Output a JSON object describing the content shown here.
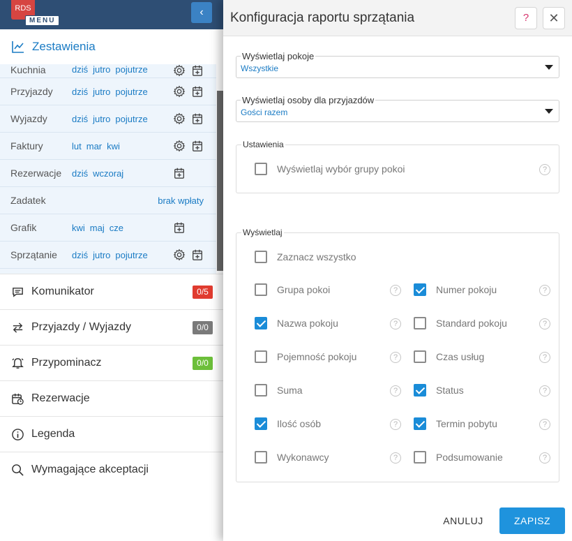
{
  "app": {
    "logo_text": "RDS",
    "menu_label": "MENU",
    "collapse_glyph": "‹"
  },
  "sidebar": {
    "section_title": "Zestawienia",
    "reports": [
      {
        "name": "Kuchnia",
        "links": [
          "dziś",
          "jutro",
          "pojutrze"
        ],
        "icons": [
          "gear-icon",
          "calendar-add-icon"
        ],
        "right_text": ""
      },
      {
        "name": "Przyjazdy",
        "links": [
          "dziś",
          "jutro",
          "pojutrze"
        ],
        "icons": [
          "gear-icon",
          "calendar-add-icon"
        ],
        "right_text": ""
      },
      {
        "name": "Wyjazdy",
        "links": [
          "dziś",
          "jutro",
          "pojutrze"
        ],
        "icons": [
          "gear-icon",
          "calendar-add-icon"
        ],
        "right_text": ""
      },
      {
        "name": "Faktury",
        "links": [
          "lut",
          "mar",
          "kwi"
        ],
        "icons": [
          "gear-icon",
          "calendar-add-icon"
        ],
        "right_text": ""
      },
      {
        "name": "Rezerwacje",
        "links": [
          "dziś",
          "wczoraj"
        ],
        "icons": [
          "calendar-add-icon"
        ],
        "right_text": ""
      },
      {
        "name": "Zadatek",
        "links": [],
        "icons": [],
        "right_text": "brak wpłaty"
      },
      {
        "name": "Grafik",
        "links": [
          "kwi",
          "maj",
          "cze"
        ],
        "icons": [
          "calendar-add-icon"
        ],
        "right_text": ""
      },
      {
        "name": "Sprzątanie",
        "links": [
          "dziś",
          "jutro",
          "pojutrze"
        ],
        "icons": [
          "gear-icon",
          "calendar-add-icon"
        ],
        "right_text": ""
      }
    ],
    "nav": [
      {
        "label": "Komunikator",
        "icon": "chat-icon",
        "badge": "0/5",
        "badge_color": "#e03b2f"
      },
      {
        "label": "Przyjazdy / Wyjazdy",
        "icon": "arrows-icon",
        "badge": "0/0",
        "badge_color": "#7a7a7a"
      },
      {
        "label": "Przypominacz",
        "icon": "alarm-icon",
        "badge": "0/0",
        "badge_color": "#6cbf3a"
      },
      {
        "label": "Rezerwacje",
        "icon": "calendar-clock-icon",
        "badge": "",
        "badge_color": ""
      },
      {
        "label": "Legenda",
        "icon": "info-icon",
        "badge": "",
        "badge_color": ""
      },
      {
        "label": "Wymagające akceptacji",
        "icon": "search-icon",
        "badge": "",
        "badge_color": ""
      }
    ]
  },
  "dialog": {
    "title": "Konfiguracja raportu sprzątania",
    "help_glyph": "?",
    "close_glyph": "✕",
    "select_rooms": {
      "label": "Wyświetlaj pokoje",
      "value": "Wszystkie"
    },
    "select_people": {
      "label": "Wyświetlaj osoby dla przyjazdów",
      "value": "Gości razem"
    },
    "settings": {
      "legend": "Ustawienia",
      "option": {
        "label": "Wyświetlaj wybór grupy pokoi",
        "checked": false
      }
    },
    "display": {
      "legend": "Wyświetlaj",
      "select_all": {
        "label": "Zaznacz wszystko",
        "checked": false
      },
      "left": [
        {
          "label": "Grupa pokoi",
          "checked": false
        },
        {
          "label": "Nazwa pokoju",
          "checked": true
        },
        {
          "label": "Pojemność pokoju",
          "checked": false
        },
        {
          "label": "Suma",
          "checked": false
        },
        {
          "label": "Ilość osób",
          "checked": true
        },
        {
          "label": "Wykonawcy",
          "checked": false
        }
      ],
      "right": [
        {
          "label": "Numer pokoju",
          "checked": true
        },
        {
          "label": "Standard pokoju",
          "checked": false
        },
        {
          "label": "Czas usług",
          "checked": false
        },
        {
          "label": "Status",
          "checked": true
        },
        {
          "label": "Termin pobytu",
          "checked": true
        },
        {
          "label": "Podsumowanie",
          "checked": false
        }
      ],
      "help_glyph": "?"
    },
    "cancel_label": "ANULUJ",
    "save_label": "ZAPISZ"
  },
  "colors": {
    "accent": "#1a7bc4",
    "topbar": "#2e4e74",
    "save": "#1f93dd",
    "checked": "#1a8cd8"
  }
}
